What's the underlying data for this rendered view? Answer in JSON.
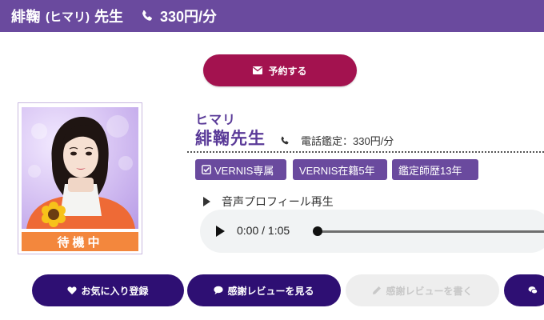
{
  "header": {
    "name": "緋鞠",
    "kana": "(ヒマリ)",
    "title_suffix": "先生",
    "price": "330円/分"
  },
  "reserve_button": {
    "label": "予約する"
  },
  "profile": {
    "status": "待機中",
    "kana_name": "ヒマリ",
    "kanji_name": "緋鞠先生",
    "phone_reading": "電話鑑定：330円/分",
    "badges": [
      "VERNIS専属",
      "VERNIS在籍5年",
      "鑑定師歴13年"
    ]
  },
  "voice": {
    "label": "音声プロフィール再生",
    "time": "0:00 / 1:05",
    "progress": 0
  },
  "actions": {
    "favorite": "お気に入り登録",
    "view_reviews": "感謝レビューを見る",
    "write_review": "感謝レビューを書く"
  },
  "colors": {
    "header_bg": "#6a4a9e",
    "reserve_bg": "#a3124f",
    "status_bg": "#f3873d",
    "action_bg": "#2e0f73"
  }
}
